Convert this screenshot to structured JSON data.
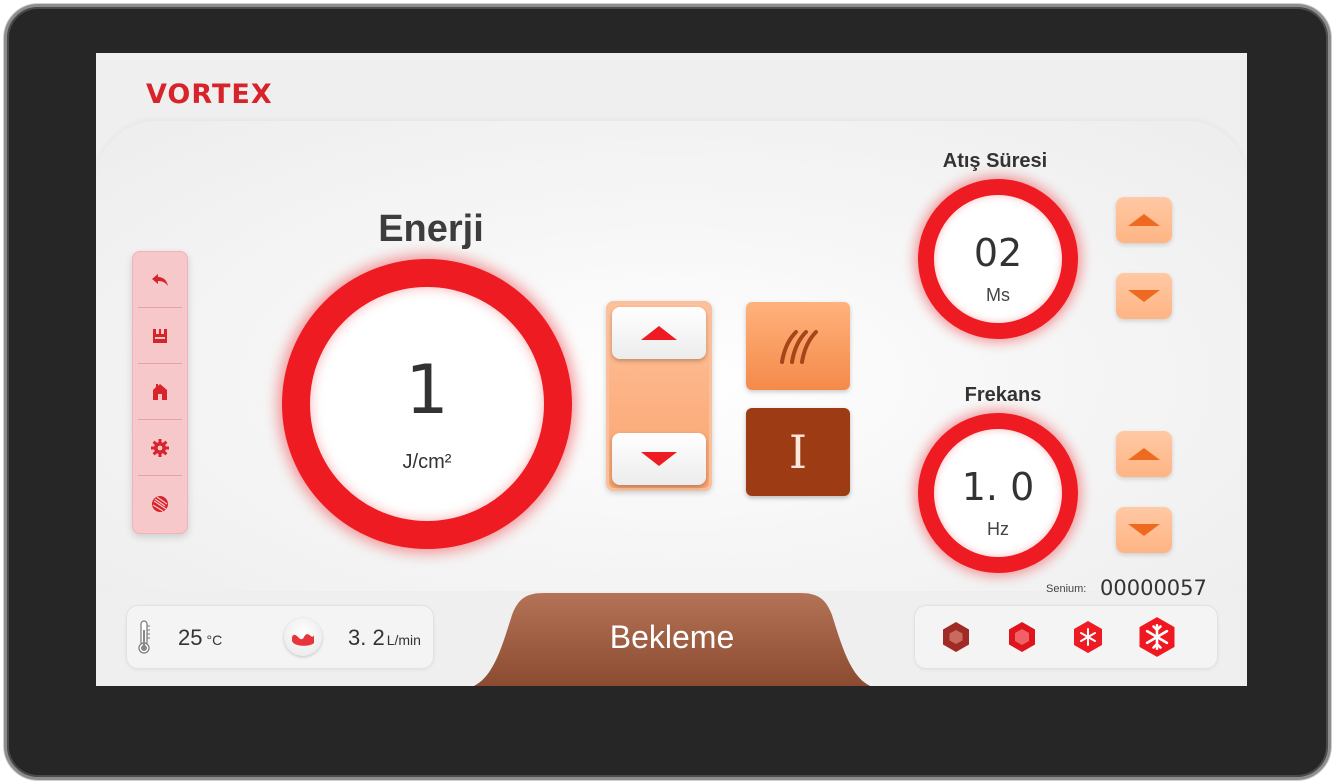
{
  "brand": {
    "logo": "VORTEX"
  },
  "side_menu": {
    "items": [
      {
        "name": "back",
        "icon": "back-arrow-icon"
      },
      {
        "name": "save",
        "icon": "save-icon"
      },
      {
        "name": "home",
        "icon": "home-icon"
      },
      {
        "name": "settings",
        "icon": "gear-icon"
      },
      {
        "name": "language",
        "icon": "globe-icon"
      }
    ]
  },
  "energy": {
    "title": "Enerji",
    "value": "1",
    "unit": "J/cm²"
  },
  "modes": {
    "heat_icon": "heat-waves-icon",
    "single_label": "I"
  },
  "pulse_duration": {
    "title": "Atış Süresi",
    "value": "02",
    "unit": "Ms"
  },
  "frequency": {
    "title": "Frekans",
    "value": "1. 0",
    "unit": "Hz"
  },
  "serial": {
    "label": "Senium:",
    "value": "00000057"
  },
  "temperature": {
    "value": "25",
    "unit": "°C",
    "icon": "thermometer-icon"
  },
  "flow": {
    "value": "3. 2",
    "unit": "L/min",
    "icon": "water-flow-icon"
  },
  "status": {
    "text": "Bekleme"
  },
  "cooling": {
    "levels": [
      {
        "name": "level-1",
        "icon": "hexagon-icon"
      },
      {
        "name": "level-2",
        "icon": "hexagon-icon"
      },
      {
        "name": "level-3",
        "icon": "snowflake-hexagon-icon"
      },
      {
        "name": "level-4",
        "icon": "snowflake-hexagon-icon"
      }
    ]
  },
  "colors": {
    "accent_red": "#ee1b22",
    "accent_orange": "#f48a4a",
    "brown": "#9c3b14"
  }
}
